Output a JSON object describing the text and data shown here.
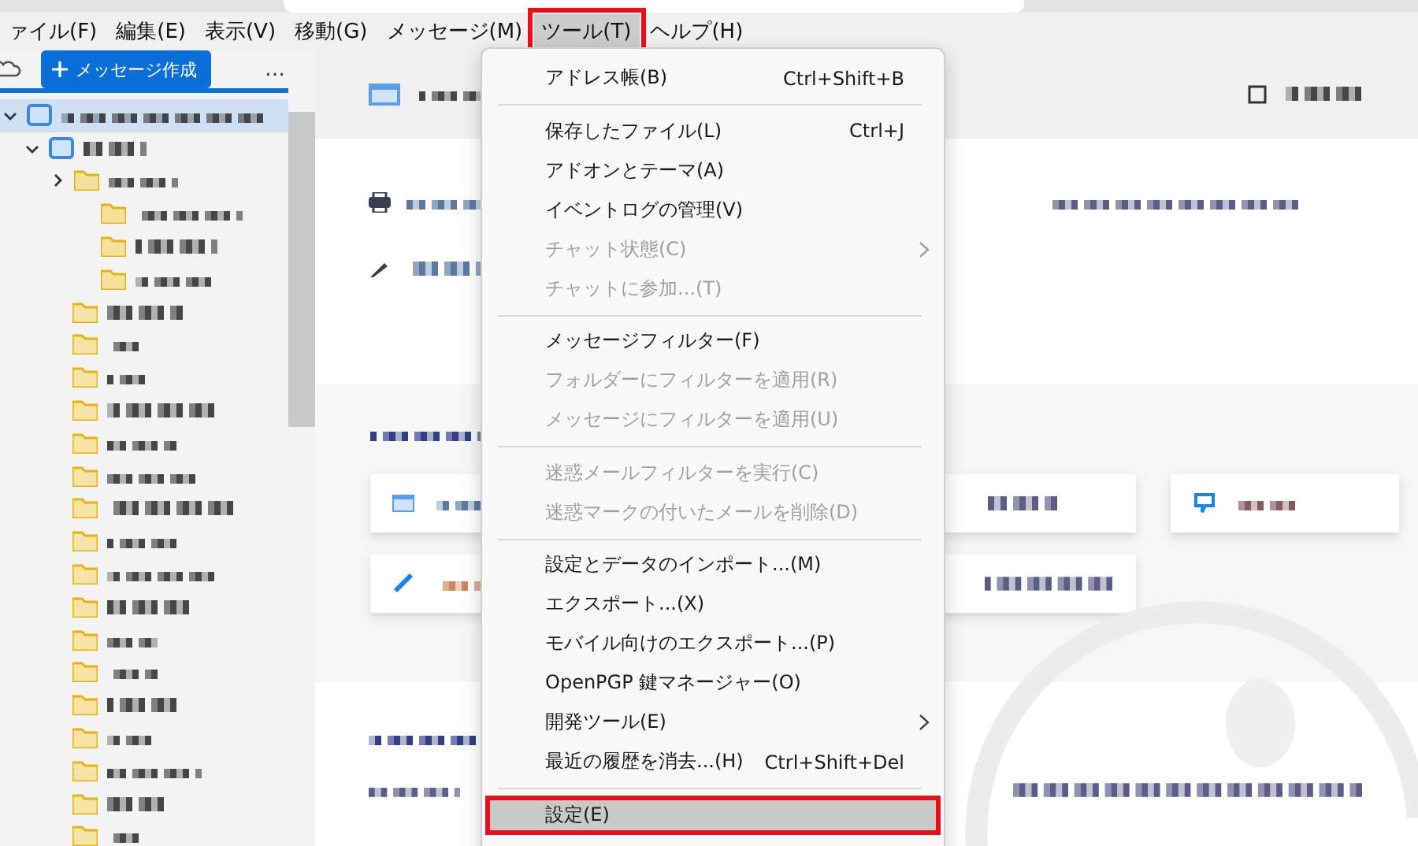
{
  "menubar": [
    {
      "label": "ァイル(F)",
      "selected": false,
      "highlighted": false
    },
    {
      "label": "編集(E)",
      "selected": false,
      "highlighted": false
    },
    {
      "label": "表示(V)",
      "selected": false,
      "highlighted": false
    },
    {
      "label": "移動(G)",
      "selected": false,
      "highlighted": false
    },
    {
      "label": "メッセージ(M)",
      "selected": false,
      "highlighted": false
    },
    {
      "label": "ツール(T)",
      "selected": true,
      "highlighted": true
    },
    {
      "label": "ヘルプ(H)",
      "selected": false,
      "highlighted": false
    }
  ],
  "sidebar": {
    "compose_button": "メッセージ作成",
    "more_button": "…"
  },
  "tools_menu": [
    {
      "kind": "item",
      "label": "アドレス帳(B)",
      "shortcut": "Ctrl+Shift+B",
      "disabled": false,
      "submenu": false,
      "selected": false,
      "highlighted": false
    },
    {
      "kind": "separator"
    },
    {
      "kind": "item",
      "label": "保存したファイル(L)",
      "shortcut": "Ctrl+J",
      "disabled": false,
      "submenu": false,
      "selected": false,
      "highlighted": false
    },
    {
      "kind": "item",
      "label": "アドオンとテーマ(A)",
      "disabled": false,
      "submenu": false,
      "selected": false,
      "highlighted": false
    },
    {
      "kind": "item",
      "label": "イベントログの管理(V)",
      "disabled": false,
      "submenu": false,
      "selected": false,
      "highlighted": false
    },
    {
      "kind": "item",
      "label": "チャット状態(C)",
      "disabled": true,
      "submenu": true,
      "selected": false,
      "highlighted": false
    },
    {
      "kind": "item",
      "label": "チャットに参加...(T)",
      "disabled": true,
      "submenu": false,
      "selected": false,
      "highlighted": false
    },
    {
      "kind": "separator"
    },
    {
      "kind": "item",
      "label": "メッセージフィルター(F)",
      "disabled": false,
      "submenu": false,
      "selected": false,
      "highlighted": false
    },
    {
      "kind": "item",
      "label": "フォルダーにフィルターを適用(R)",
      "disabled": true,
      "submenu": false,
      "selected": false,
      "highlighted": false
    },
    {
      "kind": "item",
      "label": "メッセージにフィルターを適用(U)",
      "disabled": true,
      "submenu": false,
      "selected": false,
      "highlighted": false
    },
    {
      "kind": "separator"
    },
    {
      "kind": "item",
      "label": "迷惑メールフィルターを実行(C)",
      "disabled": true,
      "submenu": false,
      "selected": false,
      "highlighted": false
    },
    {
      "kind": "item",
      "label": "迷惑マークの付いたメールを削除(D)",
      "disabled": true,
      "submenu": false,
      "selected": false,
      "highlighted": false
    },
    {
      "kind": "separator"
    },
    {
      "kind": "item",
      "label": "設定とデータのインポート...(M)",
      "disabled": false,
      "submenu": false,
      "selected": false,
      "highlighted": false
    },
    {
      "kind": "item",
      "label": "エクスポート...(X)",
      "disabled": false,
      "submenu": false,
      "selected": false,
      "highlighted": false
    },
    {
      "kind": "item",
      "label": "モバイル向けのエクスポート...(P)",
      "disabled": false,
      "submenu": false,
      "selected": false,
      "highlighted": false
    },
    {
      "kind": "item",
      "label": "OpenPGP 鍵マネージャー(O)",
      "disabled": false,
      "submenu": false,
      "selected": false,
      "highlighted": false
    },
    {
      "kind": "item",
      "label": "開発ツール(E)",
      "disabled": false,
      "submenu": true,
      "selected": false,
      "highlighted": false
    },
    {
      "kind": "item",
      "label": "最近の履歴を消去...(H)",
      "shortcut": "Ctrl+Shift+Del",
      "disabled": false,
      "submenu": false,
      "selected": false,
      "highlighted": false
    },
    {
      "kind": "separator"
    },
    {
      "kind": "item",
      "label": "設定(E)",
      "disabled": false,
      "submenu": false,
      "selected": true,
      "highlighted": true
    }
  ]
}
